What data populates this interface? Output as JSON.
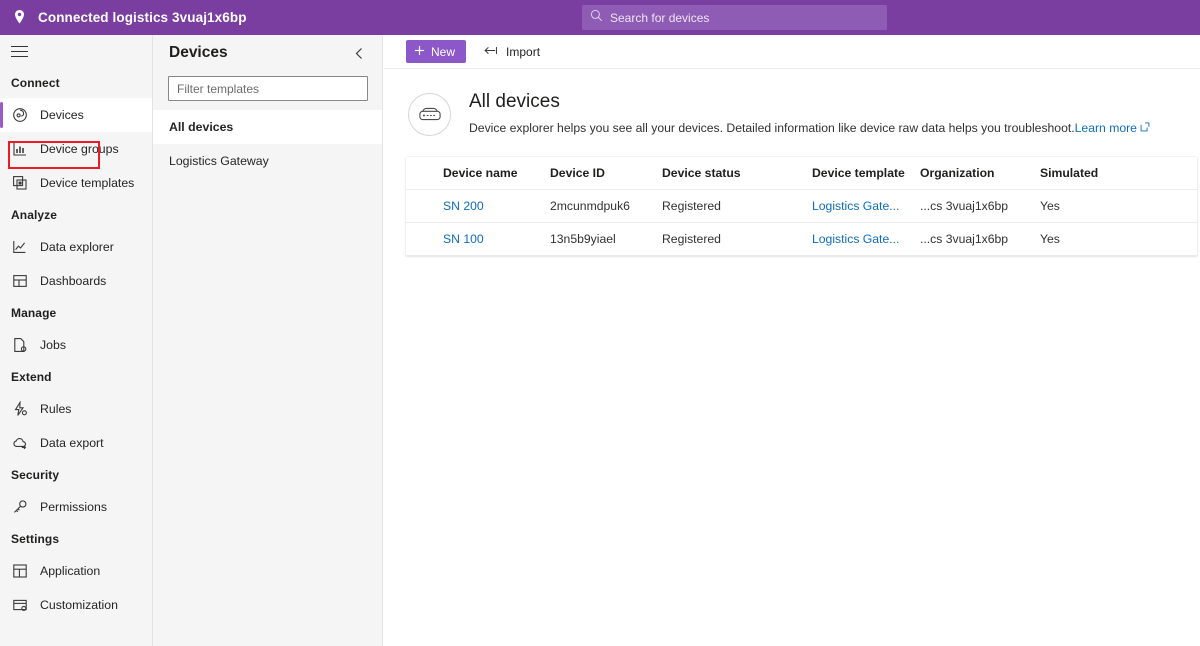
{
  "topbar": {
    "logo_icon": "location-pin-icon",
    "title": "Connected logistics 3vuaj1x6bp",
    "search_icon": "search-icon",
    "search_placeholder": "Search for devices",
    "search_value": "",
    "bg_color": "#7A3EA1"
  },
  "sidebar": {
    "menu_icon": "hamburger-menu-icon",
    "groups": [
      {
        "label": "Connect",
        "items": [
          {
            "label": "Devices",
            "icon": "devices-icon",
            "selected": true,
            "highlighted": true
          },
          {
            "label": "Device groups",
            "icon": "device-groups-icon",
            "selected": false,
            "highlighted": false
          },
          {
            "label": "Device templates",
            "icon": "device-templates-icon",
            "selected": false,
            "highlighted": false
          }
        ]
      },
      {
        "label": "Analyze",
        "items": [
          {
            "label": "Data explorer",
            "icon": "data-explorer-icon",
            "selected": false,
            "highlighted": false
          },
          {
            "label": "Dashboards",
            "icon": "dashboards-icon",
            "selected": false,
            "highlighted": false
          }
        ]
      },
      {
        "label": "Manage",
        "items": [
          {
            "label": "Jobs",
            "icon": "jobs-icon",
            "selected": false,
            "highlighted": false
          }
        ]
      },
      {
        "label": "Extend",
        "items": [
          {
            "label": "Rules",
            "icon": "rules-icon",
            "selected": false,
            "highlighted": false
          },
          {
            "label": "Data export",
            "icon": "data-export-icon",
            "selected": false,
            "highlighted": false
          }
        ]
      },
      {
        "label": "Security",
        "items": [
          {
            "label": "Permissions",
            "icon": "key-icon",
            "selected": false,
            "highlighted": false
          }
        ]
      },
      {
        "label": "Settings",
        "items": [
          {
            "label": "Application",
            "icon": "application-icon",
            "selected": false,
            "highlighted": false
          },
          {
            "label": "Customization",
            "icon": "customization-icon",
            "selected": false,
            "highlighted": false
          }
        ]
      }
    ],
    "highlight_color": "#ED1C24",
    "accent_color": "#9B5BC4"
  },
  "devices_panel": {
    "title": "Devices",
    "collapse_icon": "chevron-left-icon",
    "filter_placeholder": "Filter templates",
    "filter_value": "",
    "items": [
      {
        "label": "All devices",
        "selected": true
      },
      {
        "label": "Logistics Gateway",
        "selected": false
      }
    ]
  },
  "toolbar": {
    "new_label": "New",
    "new_icon": "plus-icon",
    "import_label": "Import",
    "import_icon": "import-arrow-icon",
    "new_button_color": "#8C57C9"
  },
  "page": {
    "icon": "device-explorer-icon",
    "title": "All devices",
    "description": "Device explorer helps you see all your devices. Detailed information like device raw data helps you troubleshoot. ",
    "learn_more_label": "Learn more",
    "learn_more_icon": "open-in-new-icon",
    "link_color": "#0F6CBD"
  },
  "table": {
    "columns": [
      "Device name",
      "Device ID",
      "Device status",
      "Device template",
      "Organization",
      "Simulated"
    ],
    "rows": [
      {
        "device_name": "SN 200",
        "device_id": "2mcunmdpuk6",
        "device_status": "Registered",
        "device_template": "Logistics Gate...",
        "organization": "...cs 3vuaj1x6bp",
        "simulated": "Yes"
      },
      {
        "device_name": "SN 100",
        "device_id": "13n5b9yiael",
        "device_status": "Registered",
        "device_template": "Logistics Gate...",
        "organization": "...cs 3vuaj1x6bp",
        "simulated": "Yes"
      }
    ]
  }
}
